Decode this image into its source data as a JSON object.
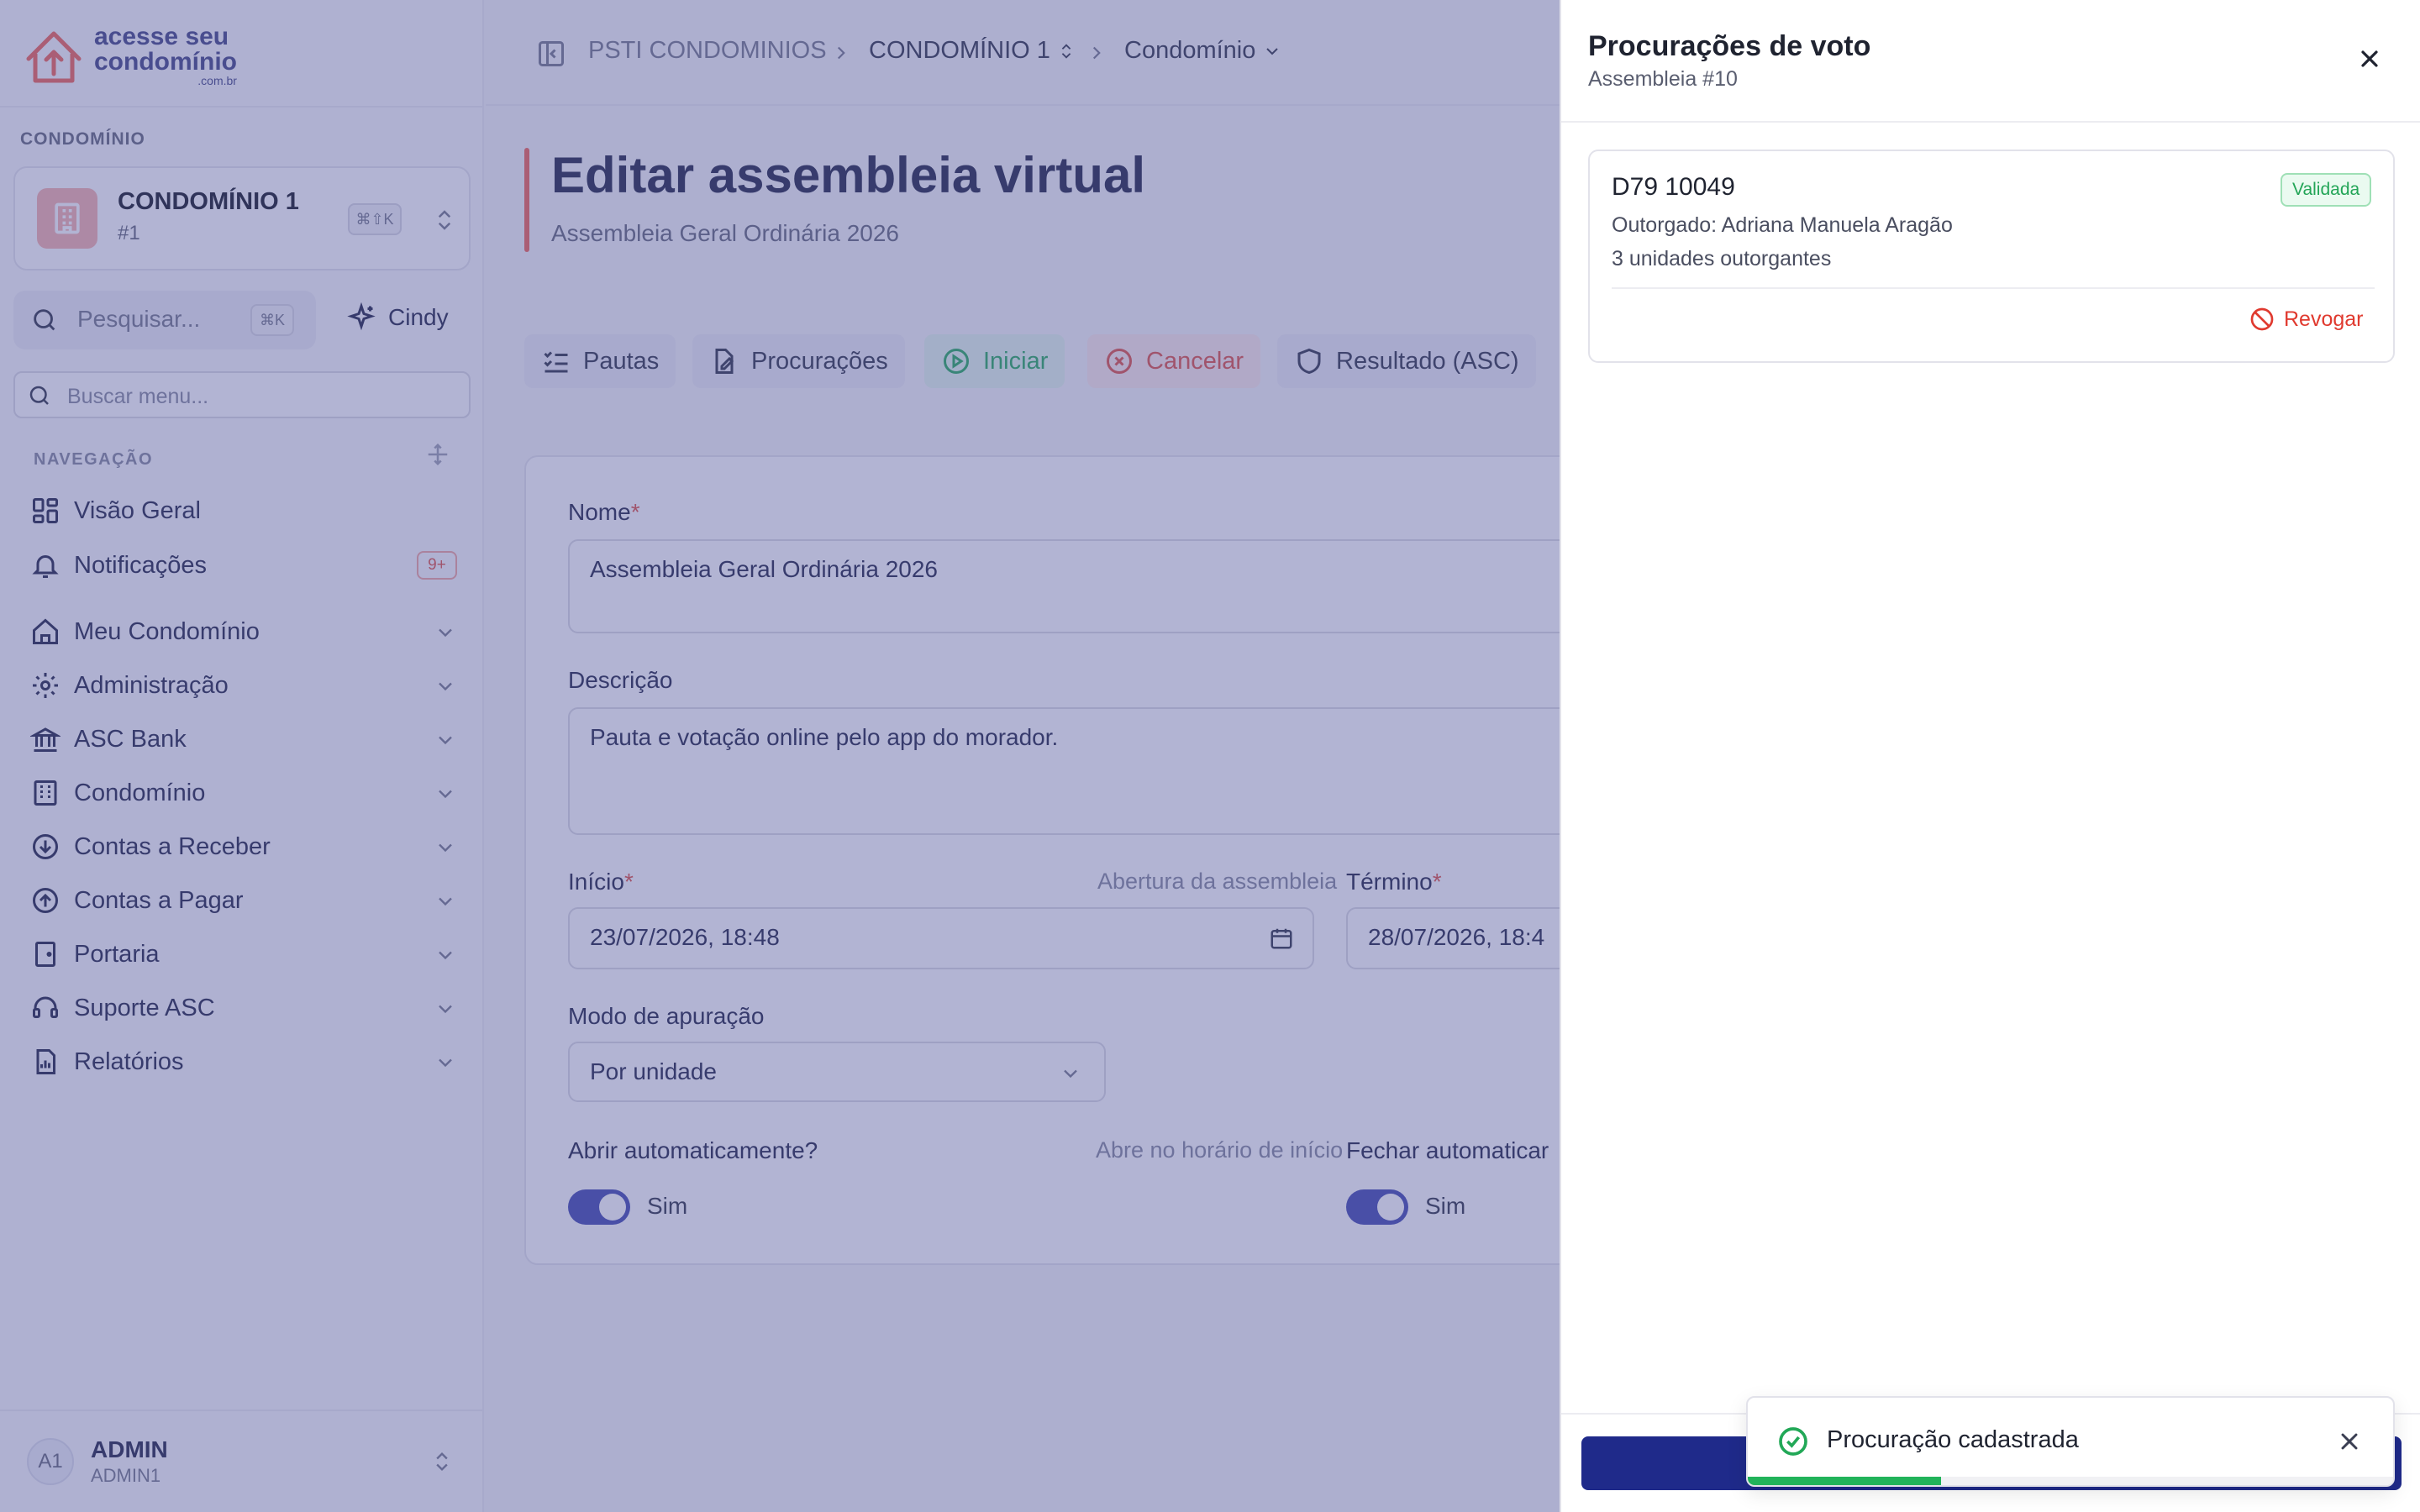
{
  "sidebar": {
    "logo": {
      "line1": "acesse seu",
      "line2": "condomínio",
      "line3": ".com.br"
    },
    "section_label": "CONDOMÍNIO",
    "condo": {
      "name": "CONDOMÍNIO 1",
      "sub": "#1",
      "shortcut": "⌘⇧K"
    },
    "search": {
      "placeholder": "Pesquisar...",
      "shortcut": "⌘K"
    },
    "ai_label": "Cindy",
    "menu_search_placeholder": "Buscar menu...",
    "nav_label": "NAVEGAÇÃO",
    "items": [
      {
        "label": "Visão Geral",
        "icon": "grid-icon"
      },
      {
        "label": "Notificações",
        "icon": "bell-icon",
        "badge": "9+"
      },
      {
        "label": "Meu Condomínio",
        "icon": "home-icon"
      },
      {
        "label": "Administração",
        "icon": "gear-icon"
      },
      {
        "label": "ASC Bank",
        "icon": "bank-icon"
      },
      {
        "label": "Condomínio",
        "icon": "building-icon"
      },
      {
        "label": "Contas a Receber",
        "icon": "arrow-down-circle-icon"
      },
      {
        "label": "Contas a Pagar",
        "icon": "arrow-up-circle-icon"
      },
      {
        "label": "Portaria",
        "icon": "door-icon"
      },
      {
        "label": "Suporte ASC",
        "icon": "headset-icon"
      },
      {
        "label": "Relatórios",
        "icon": "report-icon"
      }
    ],
    "user": {
      "initials": "A1",
      "name": "ADMIN",
      "role": "ADMIN1"
    }
  },
  "main": {
    "breadcrumb": [
      "PSTI CONDOMINIOS",
      "CONDOMÍNIO 1",
      "Condomínio"
    ],
    "title": "Editar assembleia virtual",
    "subtitle": "Assembleia Geral Ordinária 2026",
    "tabs": [
      {
        "label": "Pautas"
      },
      {
        "label": "Procurações"
      },
      {
        "label": "Iniciar"
      },
      {
        "label": "Cancelar"
      },
      {
        "label": "Resultado (ASC)"
      }
    ],
    "form": {
      "name_label": "Nome",
      "name_value": "Assembleia Geral Ordinária 2026",
      "desc_label": "Descrição",
      "desc_value": "Pauta e votação online pelo app do morador.",
      "start_label": "Início",
      "start_hint": "Abertura da assembleia",
      "start_value": "23/07/2026, 18:48",
      "end_label": "Término",
      "end_value": "28/07/2026, 18:4",
      "mode_label": "Modo de apuração",
      "mode_value": "Por unidade",
      "auto_open_label": "Abrir automaticamente?",
      "auto_open_hint": "Abre no horário de início",
      "auto_open_value": "Sim",
      "auto_close_label": "Fechar automaticar",
      "auto_close_value": "Sim"
    }
  },
  "drawer": {
    "title": "Procurações de voto",
    "subtitle": "Assembleia #10",
    "proxies": [
      {
        "unit": "D79 10049",
        "status": "Validada",
        "grantee": "Outorgado: Adriana Manuela Aragão",
        "units": "3 unidades outorgantes",
        "revoke_label": "Revogar"
      }
    ]
  },
  "toast": {
    "message": "Procuração cadastrada",
    "progress": 0.3
  },
  "colors": {
    "accent": "#4a52b4",
    "brand_red": "#f26b5e",
    "success": "#22b35a",
    "danger": "#e03a2f",
    "primary_dark": "#1f2a8a"
  }
}
